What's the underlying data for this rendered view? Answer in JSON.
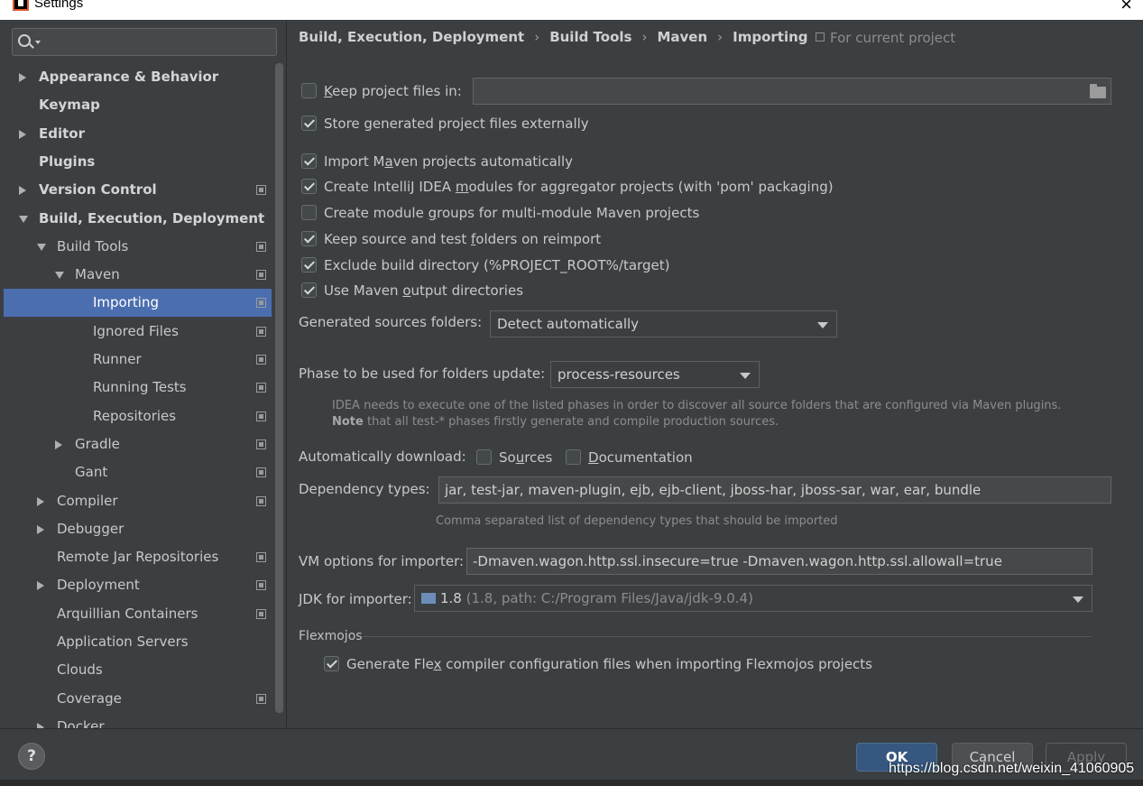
{
  "window": {
    "title": "Settings",
    "close_glyph": "×"
  },
  "search": {
    "placeholder": ""
  },
  "tree": [
    {
      "label": "Appearance & Behavior",
      "bold": true,
      "arrow": "right",
      "indent": 0,
      "proj": false
    },
    {
      "label": "Keymap",
      "bold": true,
      "arrow": "none",
      "indent": 0,
      "proj": false
    },
    {
      "label": "Editor",
      "bold": true,
      "arrow": "right",
      "indent": 0,
      "proj": false
    },
    {
      "label": "Plugins",
      "bold": true,
      "arrow": "none",
      "indent": 0,
      "proj": false
    },
    {
      "label": "Version Control",
      "bold": true,
      "arrow": "right",
      "indent": 0,
      "proj": true
    },
    {
      "label": "Build, Execution, Deployment",
      "bold": true,
      "arrow": "down",
      "indent": 0,
      "proj": false
    },
    {
      "label": "Build Tools",
      "bold": false,
      "arrow": "down",
      "indent": 1,
      "proj": true
    },
    {
      "label": "Maven",
      "bold": false,
      "arrow": "down",
      "indent": 2,
      "proj": true
    },
    {
      "label": "Importing",
      "bold": false,
      "arrow": "none",
      "indent": 3,
      "proj": true,
      "selected": true
    },
    {
      "label": "Ignored Files",
      "bold": false,
      "arrow": "none",
      "indent": 3,
      "proj": true
    },
    {
      "label": "Runner",
      "bold": false,
      "arrow": "none",
      "indent": 3,
      "proj": true
    },
    {
      "label": "Running Tests",
      "bold": false,
      "arrow": "none",
      "indent": 3,
      "proj": true
    },
    {
      "label": "Repositories",
      "bold": false,
      "arrow": "none",
      "indent": 3,
      "proj": true
    },
    {
      "label": "Gradle",
      "bold": false,
      "arrow": "right",
      "indent": 2,
      "proj": true
    },
    {
      "label": "Gant",
      "bold": false,
      "arrow": "none",
      "indent": 2,
      "proj": true
    },
    {
      "label": "Compiler",
      "bold": false,
      "arrow": "right",
      "indent": 1,
      "proj": true
    },
    {
      "label": "Debugger",
      "bold": false,
      "arrow": "right",
      "indent": 1,
      "proj": false
    },
    {
      "label": "Remote Jar Repositories",
      "bold": false,
      "arrow": "none",
      "indent": 1,
      "proj": true
    },
    {
      "label": "Deployment",
      "bold": false,
      "arrow": "right",
      "indent": 1,
      "proj": true
    },
    {
      "label": "Arquillian Containers",
      "bold": false,
      "arrow": "none",
      "indent": 1,
      "proj": true
    },
    {
      "label": "Application Servers",
      "bold": false,
      "arrow": "none",
      "indent": 1,
      "proj": false
    },
    {
      "label": "Clouds",
      "bold": false,
      "arrow": "none",
      "indent": 1,
      "proj": false
    },
    {
      "label": "Coverage",
      "bold": false,
      "arrow": "none",
      "indent": 1,
      "proj": true
    },
    {
      "label": "Docker",
      "bold": false,
      "arrow": "right",
      "indent": 1,
      "proj": false
    }
  ],
  "breadcrumb": {
    "items": [
      "Build, Execution, Deployment",
      "Build Tools",
      "Maven",
      "Importing"
    ],
    "separator": "›",
    "for_project": "For current project"
  },
  "options": {
    "keep_files": {
      "pre": "",
      "u": "K",
      "post": "eep project files in:",
      "checked": false,
      "path": ""
    },
    "store_externally": {
      "pre": "Store generated project files externally",
      "u": "",
      "post": "",
      "checked": true
    },
    "import_auto": {
      "pre": "Import M",
      "u": "a",
      "post": "ven projects automatically",
      "checked": true
    },
    "create_modules": {
      "pre": "Create IntelliJ IDEA ",
      "u": "m",
      "post": "odules for aggregator projects (with 'pom' packaging)",
      "checked": true
    },
    "module_groups": {
      "pre": "Create module ",
      "u": "g",
      "post": "roups for multi-module Maven projects",
      "checked": false
    },
    "keep_source": {
      "pre": "Keep source and test ",
      "u": "f",
      "post": "olders on reimport",
      "checked": true
    },
    "exclude_build": {
      "pre": "Exclude build directory (%PROJECT_ROOT%/target)",
      "u": "",
      "post": "",
      "checked": true
    },
    "use_output": {
      "pre": "Use Maven ",
      "u": "o",
      "post": "utput directories",
      "checked": true
    }
  },
  "generated_sources": {
    "label": "Generated sources folders:",
    "value": "Detect automatically"
  },
  "phase": {
    "label": "Phase to be used for folders update:",
    "value": "process-resources",
    "hint_line1": "IDEA needs to execute one of the listed phases in order to discover all source folders that are configured via Maven plugins.",
    "hint_note_bold": "Note",
    "hint_line2": " that all test-* phases firstly generate and compile production sources."
  },
  "auto_download": {
    "label": "Automatically download:",
    "sources": {
      "pre": "So",
      "u": "u",
      "post": "rces",
      "checked": false
    },
    "documentation": {
      "pre": "",
      "u": "D",
      "post": "ocumentation",
      "checked": false
    }
  },
  "dependency_types": {
    "label": "Dependency types:",
    "value": "jar, test-jar, maven-plugin, ejb, ejb-client, jboss-har, jboss-sar, war, ear, bundle",
    "hint": "Comma separated list of dependency types that should be imported"
  },
  "vm_options": {
    "label": "VM options for importer:",
    "value": "-Dmaven.wagon.http.ssl.insecure=true -Dmaven.wagon.http.ssl.allowall=true"
  },
  "jdk": {
    "label": "JDK for importer:",
    "value": "1.8",
    "detail": " (1.8, path: C:/Program Files/Java/jdk-9.0.4)"
  },
  "flexmojos": {
    "title": "Flexmojos",
    "generate": {
      "pre": "Generate Fle",
      "u": "x",
      "post": " compiler configuration files when importing Flexmojos projects",
      "checked": true
    }
  },
  "buttons": {
    "help": "?",
    "ok": "OK",
    "cancel": "Cancel",
    "apply": "Apply"
  },
  "watermark": "https://blog.csdn.net/weixin_41060905"
}
